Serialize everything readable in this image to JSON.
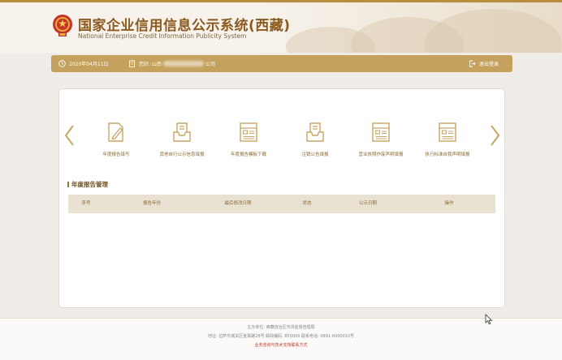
{
  "header": {
    "title_cn": "国家企业信用信息公示系统(西藏)",
    "title_en": "National Enterprise Credit Information Publicity System"
  },
  "userbar": {
    "date": "2020年04月11日",
    "company_prefix": "您好: 山南",
    "company_suffix": "公司",
    "logout_label": "退出登录"
  },
  "functions": [
    {
      "label": "年度报告填写",
      "icon": "edit-report-icon"
    },
    {
      "label": "其他自行公示信息填报",
      "icon": "inbox-tray-icon"
    },
    {
      "label": "年度报告模板下载",
      "icon": "form-document-icon"
    },
    {
      "label": "注销公告填报",
      "icon": "inbox-tray-icon"
    },
    {
      "label": "营业执照作废声明填报",
      "icon": "form-document-icon"
    },
    {
      "label": "执行标准自我声明填报",
      "icon": "form-document-icon"
    }
  ],
  "section": {
    "title": "年度报告管理"
  },
  "table": {
    "columns": [
      "序号",
      "报告年份",
      "最后修改日期",
      "状态",
      "公示日期",
      "操作"
    ]
  },
  "footer": {
    "line1": "主办单位: 西藏自治区市场监督管理局",
    "line2": "地址: 拉萨市城关区金珠路28号  邮政编码: 850000  联系电话: 0891-6000010号",
    "link": "业务咨询与技术支持联系方式"
  },
  "colors": {
    "accent": "#c4a15c",
    "brand_text": "#8a5a1e",
    "link": "#c0392b"
  }
}
